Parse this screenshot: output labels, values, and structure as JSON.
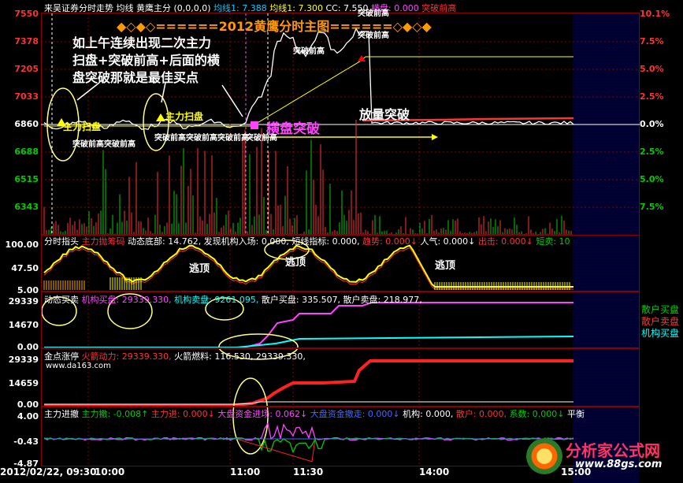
{
  "header": {
    "title": "来吴证券分时走势",
    "items": [
      {
        "text": "均线",
        "color": "#ffffff"
      },
      {
        "text": "黄鹰主分 (0,0,0,0)",
        "color": "#ffffff"
      },
      {
        "text": "均线1: 7.388",
        "color": "#00ccff"
      },
      {
        "text": "均线1: 7.300",
        "color": "#ffff00"
      },
      {
        "text": "CC: 7.550",
        "color": "#ffffff"
      },
      {
        "text": "横盘: 0.000",
        "color": "#ff44ff"
      },
      {
        "text": "突破前高",
        "color": "#ff3333"
      }
    ]
  },
  "main": {
    "banner": "◆◇◆◇======2012黄鹰分时主图======◇◆◇◆",
    "price_labels": [
      "7550",
      "7378",
      "7205",
      "7033",
      "6860",
      "6688",
      "6515",
      "6343"
    ],
    "pct_labels": [
      "10.1%",
      "7.5%",
      "5.0%",
      "2.5%",
      "0.0%",
      "2.5%",
      "5.0%",
      "7.5%"
    ],
    "note": "如上午连续出现二次主力\n扫盘+突破前高+后面的横\n盘突破那就是最佳买点",
    "label_main1": "主力扫盘",
    "label_main2": "主力扫盘",
    "label_break1": "突破前高突破前高",
    "label_break2": "突破前高突破前高突破前高",
    "label_break3": "突破前高",
    "label_break4": "突破前高",
    "label_break5": "突破前高",
    "label_break6": "突破前高",
    "label_hbreak": "横盘突破",
    "label_volbreak": "放量突破"
  },
  "panel2": {
    "header": [
      {
        "text": "分时指头",
        "color": "#ffffff"
      },
      {
        "text": "主力抛筹码",
        "color": "#ff3333"
      },
      {
        "text": "动态底部: 14.762,",
        "color": "#ffffff"
      },
      {
        "text": "发现机构入场: 0.000,",
        "color": "#ffffff"
      },
      {
        "text": "短线指标: 0.000,",
        "color": "#ffffff"
      },
      {
        "text": "趋势: 0.000↓",
        "color": "#ff3333"
      },
      {
        "text": "人气: 0.000↓",
        "color": "#ffffff"
      },
      {
        "text": "出击: 0.000↓",
        "color": "#ff3333"
      },
      {
        "text": "短卖: 10",
        "color": "#00cc00"
      }
    ],
    "axis": [
      "100.00",
      "47.50",
      "5.00"
    ],
    "escape_labels": [
      "逃顶",
      "逃顶",
      "逃顶"
    ]
  },
  "panel3": {
    "header": [
      {
        "text": "动态买卖",
        "color": "#ffffff"
      },
      {
        "text": "机构买盘: 29339.330,",
        "color": "#ff44ff"
      },
      {
        "text": "机构卖盘: 9261.095,",
        "color": "#00ffff"
      },
      {
        "text": "散户买盘: 335.507,",
        "color": "#ffffff"
      },
      {
        "text": "散户卖盘: 218.977,",
        "color": "#ffffff"
      }
    ],
    "axis": [
      "29339",
      "14670",
      "0.00"
    ],
    "legend": [
      {
        "text": "散户买盘",
        "color": "#00cc00"
      },
      {
        "text": "散户卖盘",
        "color": "#ff3333"
      },
      {
        "text": "机构买盘",
        "color": "#00ffff"
      }
    ]
  },
  "panel4": {
    "header": [
      {
        "text": "金点涨停",
        "color": "#ffffff"
      },
      {
        "text": "火箭动力: 29339.330,",
        "color": "#ff3333"
      },
      {
        "text": "火箭燃料: 116.530,",
        "color": "#ffffff"
      },
      {
        "text": "29339.330,",
        "color": "#ffffff"
      }
    ],
    "site": "www.da163.com",
    "axis": [
      "29339",
      "14659",
      "0.00"
    ]
  },
  "panel5": {
    "header": [
      {
        "text": "主力进撤",
        "color": "#ffffff"
      },
      {
        "text": "主力撤: -0.008↑",
        "color": "#00cc00"
      },
      {
        "text": "主力进: 0.000↓",
        "color": "#ff3333"
      },
      {
        "text": "大盘资金进场: 0.062↓",
        "color": "#ff44ff"
      },
      {
        "text": "大盘资金撤走: 0.000↓",
        "color": "#4466ff"
      },
      {
        "text": "机构: 0.000,",
        "color": "#ffffff"
      },
      {
        "text": "散户: 0.000,",
        "color": "#ff3333"
      },
      {
        "text": "系数: 0.000↓",
        "color": "#00cc00"
      },
      {
        "text": "平衡",
        "color": "#ffffff"
      }
    ],
    "axis": [
      "4.00",
      "-0.43",
      "-4.87"
    ]
  },
  "time_axis": [
    "2012/02/22, 09:30",
    "10:00",
    "11:00",
    "11:30",
    "14:00",
    "15:00"
  ],
  "watermark": {
    "name": "分析家公式网",
    "url": "www.88gs.com"
  },
  "colors": {
    "up": "#ff3333",
    "down": "#00cc00",
    "grid": "#8a0000",
    "yellow": "#ffff00"
  }
}
